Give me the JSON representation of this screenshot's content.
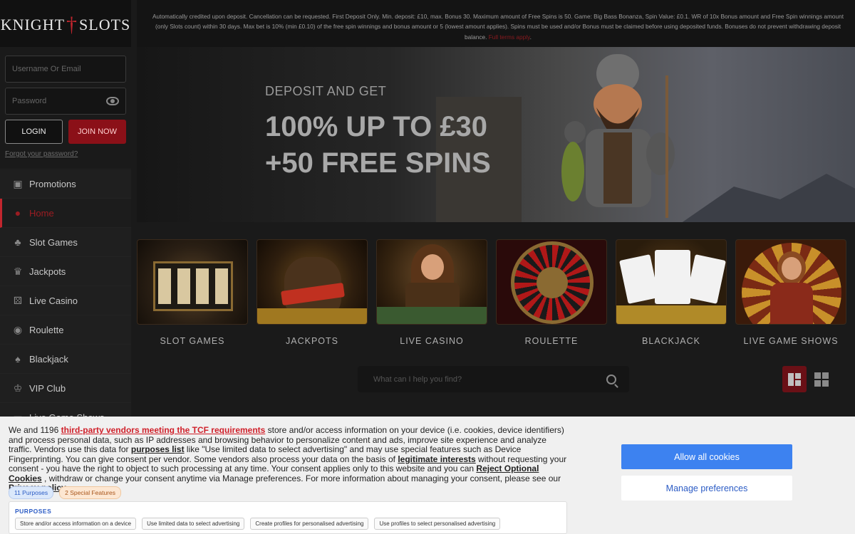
{
  "logo": {
    "left": "KNIGHT",
    "right": "SLOTS"
  },
  "login": {
    "username_placeholder": "Username Or Email",
    "password_placeholder": "Password",
    "login_label": "LOGIN",
    "join_label": "JOIN NOW",
    "forgot_label": "Forgot your password?"
  },
  "nav": {
    "items": [
      {
        "label": "Promotions",
        "icon": "gift-icon"
      },
      {
        "label": "Home",
        "icon": "home-icon",
        "active": true
      },
      {
        "label": "Slot Games",
        "icon": "cherries-icon"
      },
      {
        "label": "Jackpots",
        "icon": "trophy-icon"
      },
      {
        "label": "Live Casino",
        "icon": "dice-icon"
      },
      {
        "label": "Roulette",
        "icon": "roulette-icon"
      },
      {
        "label": "Blackjack",
        "icon": "cards-icon"
      },
      {
        "label": "VIP Club",
        "icon": "crown-icon"
      },
      {
        "label": "Live Game Shows",
        "icon": "tv-icon"
      }
    ]
  },
  "terms": {
    "text": "Automatically credited upon deposit. Cancellation can be requested. First Deposit Only. Min. deposit: £10, max. Bonus 30. Maximum amount of Free Spins is 50. Game: Big Bass Bonanza, Spin Value: £0.1. WR of 10x Bonus amount and Free Spin winnings amount (only Slots count) within 30 days. Max bet is 10% (min £0.10) of the free spin winnings and bonus amount or 5 (lowest amount applies). Spins must be used and/or Bonus must be claimed before using deposited funds. Bonuses do not prevent withdrawing deposit balance.",
    "link": "Full terms apply",
    "end": "."
  },
  "hero": {
    "subtitle": "DEPOSIT AND GET",
    "line1": "100% UP TO £30",
    "line2": "+50 FREE SPINS"
  },
  "categories": [
    {
      "label": "SLOT GAMES"
    },
    {
      "label": "JACKPOTS"
    },
    {
      "label": "LIVE CASINO"
    },
    {
      "label": "ROULETTE"
    },
    {
      "label": "BLACKJACK"
    },
    {
      "label": "LIVE GAME SHOWS"
    }
  ],
  "search": {
    "placeholder": "What can I help you find?"
  },
  "cookie": {
    "p1": "We and 1196 ",
    "vendors_link": "third-party vendors meeting the TCF requirements",
    "p2": " store and/or access information on your device (i.e. cookies, device identifiers) and process personal data, such as IP addresses and browsing behavior to personalize content and ads, improve site experience and analyze traffic. Vendors use this data for ",
    "purposes_link": "purposes list",
    "p3": " like \"Use limited data to select advertising\" and may use special features such as Device Fingerprinting. You can give consent per vendor. Some vendors also process your data on the basis of ",
    "legit_link": "legitimate interests",
    "p4": " without requesting your consent - you have the right to object to such processing at any time. Your consent applies only to this website and you can ",
    "reject_link": "Reject Optional Cookies",
    "p5": " , withdraw or change your consent anytime via Manage preferences. For more information about managing your consent, please see our ",
    "privacy_link": "Privacy policy",
    "tag_purposes": "11 Purposes",
    "tag_special": "2 Special Features",
    "purposes_title": "PURPOSES",
    "purpose_items": [
      "Store and/or access information on a device",
      "Use limited data to select advertising",
      "Create profiles for personalised advertising",
      "Use profiles to select personalised advertising"
    ],
    "allow_label": "Allow all cookies",
    "manage_label": "Manage preferences"
  },
  "colors": {
    "accent": "#c2262e",
    "cookie_button": "#3d82f0"
  }
}
